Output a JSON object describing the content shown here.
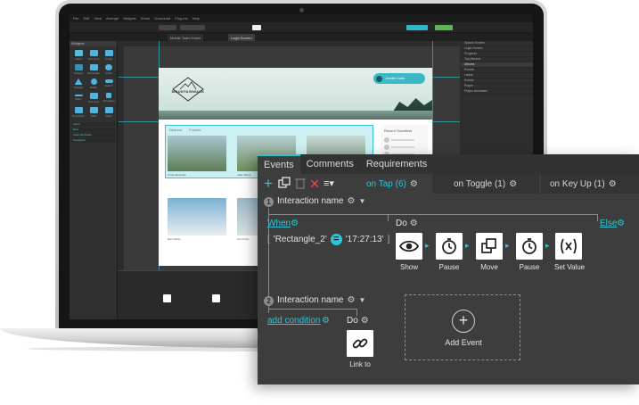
{
  "editor": {
    "menu": [
      "File",
      "Edit",
      "View",
      "Arrange",
      "Widgets",
      "Share",
      "Download",
      "Plug-ins",
      "Help"
    ],
    "page_tabs": [
      "Mobile Team Home",
      "Login Screen"
    ],
    "widget_panel_title": "Widgets",
    "widgets": [
      "Label",
      "Text Input",
      "Image",
      "Hotspot",
      "Rectangle",
      "Circle",
      "Triangle",
      "Radio",
      "Switch",
      "Slider",
      "Text Area",
      "Checkbox",
      "Dropdown",
      "Table",
      "Video"
    ],
    "library_items": [
      "Alerts",
      "Bars",
      "Calendar/Dates",
      "Navigation"
    ],
    "site": {
      "logo": "MOUNTAINWALK",
      "user_chip": "Jennifer Davis",
      "tabs": [
        "Nearest",
        "Popular"
      ],
      "sidebar_title": "Recent Travellers",
      "captions": [
        "Crazy Mountain",
        "Lake Tahoe",
        "Dan Cabot",
        "Lion Fries"
      ]
    },
    "right_panel_items": [
      "Splash Screen",
      "Login Screen",
      "Progress",
      "Top Albums",
      "Albums",
      "Events",
      "Latest",
      "Events",
      "Player",
      "Player Animated"
    ]
  },
  "events_panel": {
    "tabs": [
      {
        "label": "Events",
        "active": true
      },
      {
        "label": "Comments",
        "active": false
      },
      {
        "label": "Requirements",
        "active": false
      }
    ],
    "event_tabs": [
      {
        "label": "on Tap (6)",
        "active": true
      },
      {
        "label": "on Toggle (1)",
        "active": false
      },
      {
        "label": "on Key Up (1)",
        "active": false
      }
    ],
    "interaction1": {
      "number": "1",
      "name": "Interaction name",
      "when_label": "When",
      "else_label": "Else",
      "do_label": "Do",
      "condition": {
        "left": "'Rectangle_2'",
        "operator": "=",
        "right": "'17:27:13'"
      },
      "actions": [
        {
          "label": "Show",
          "icon": "eye-icon"
        },
        {
          "label": "Pause",
          "icon": "stopwatch-icon"
        },
        {
          "label": "Move",
          "icon": "move-layers-icon"
        },
        {
          "label": "Pause",
          "icon": "stopwatch-icon"
        },
        {
          "label": "Set Value",
          "icon": "set-value-icon"
        }
      ]
    },
    "interaction2": {
      "number": "2",
      "name": "Interaction name",
      "add_condition": "add condition",
      "do_label": "Do",
      "action": {
        "label": "Link to",
        "icon": "link-icon"
      }
    },
    "add_event_label": "Add Event",
    "accent": "#2fc5d6"
  }
}
